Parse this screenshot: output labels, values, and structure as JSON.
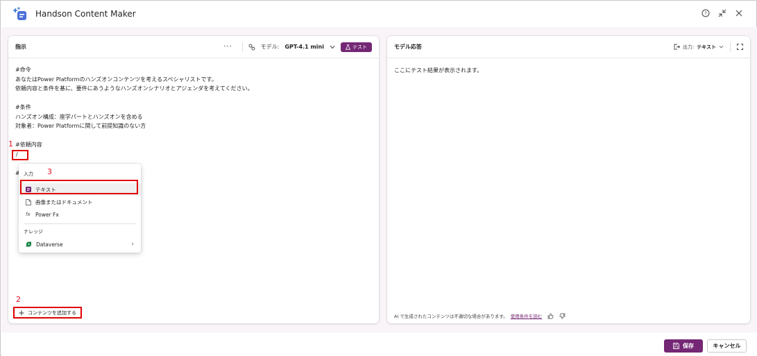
{
  "app": {
    "title": "Handson Content Maker"
  },
  "left_panel": {
    "title": "指示",
    "more_label": "···",
    "model_label": "モデル:",
    "model_value": "GPT-4.1 mini",
    "test_label": "テスト",
    "prompt_lines": [
      "#命令",
      "あなたはPower Platformのハンズオンコンテンツを考えるスペシャリストです。",
      "依頼内容と条件を基に、要件にあうようなハンズオンシナリオとアジェンダを考えてください。",
      "",
      "#条件",
      "ハンズオン構成：座学パートとハンズオンを含める",
      "対象者：Power Platformに関して前提知識のない方",
      "",
      "#依頼内容",
      "/",
      "",
      "#"
    ],
    "add_content_label": "コンテンツを追加する"
  },
  "popup": {
    "input_section": "入力",
    "items": [
      {
        "label": "テキスト",
        "icon": "text-icon"
      },
      {
        "label": "画像またはドキュメント",
        "icon": "document-icon"
      },
      {
        "label": "Power Fx",
        "icon": "fx-icon"
      }
    ],
    "knowledge_section": "ナレッジ",
    "knowledge_items": [
      {
        "label": "Dataverse",
        "icon": "dataverse-icon"
      }
    ]
  },
  "annotations": {
    "marker1": "1",
    "marker2": "2",
    "marker3": "3"
  },
  "right_panel": {
    "title": "モデル応答",
    "output_label": "出力:",
    "output_value": "テキスト",
    "placeholder_text": "ここにテスト結果が表示されます。",
    "footer_note": "AI で生成されたコンテンツは不適切な場合があります。",
    "footer_link": "使用条件を読む"
  },
  "bottom": {
    "save_label": "保存",
    "cancel_label": "キャンセル"
  },
  "colors": {
    "accent": "#742774",
    "annotation_red": "#e00000"
  }
}
